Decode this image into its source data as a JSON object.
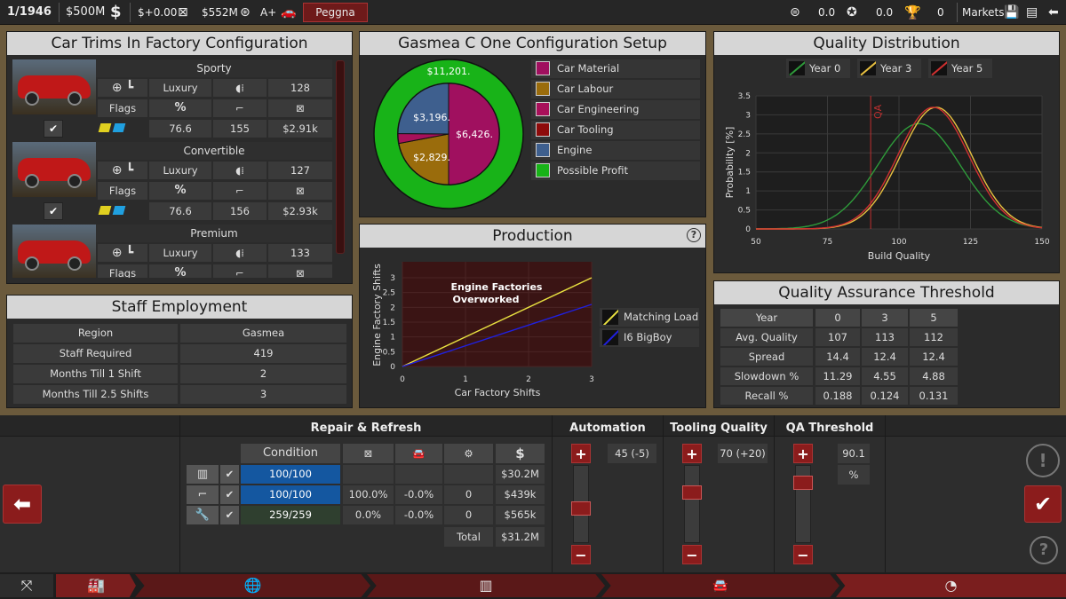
{
  "topbar": {
    "date": "1/1946",
    "money": "$500M",
    "income": "$+0.00",
    "value": "$552M",
    "rating": "A+",
    "company": "Peggna",
    "stat1": "0.0",
    "stat2": "0.0",
    "trophies": "0",
    "markets": "Markets"
  },
  "trims": {
    "title": "Car Trims In Factory Configuration",
    "items": [
      {
        "name": "Sporty",
        "tier": "Luxury",
        "sold": "128",
        "flags": "Flags",
        "pct_icon": "%",
        "v1": "76.6",
        "v2": "155",
        "price": "$2.91k"
      },
      {
        "name": "Convertible",
        "tier": "Luxury",
        "sold": "127",
        "flags": "Flags",
        "pct_icon": "%",
        "v1": "76.6",
        "v2": "156",
        "price": "$2.93k"
      },
      {
        "name": "Premium",
        "tier": "Luxury",
        "sold": "133",
        "flags": "Flags"
      }
    ]
  },
  "config": {
    "title": "Gasmea C One Configuration Setup",
    "pie_labels": {
      "profit": "$11,201.",
      "engine": "$3,196.",
      "material": "$6,426.",
      "labour": "$2,829."
    },
    "legend": [
      {
        "label": "Car Material",
        "color": "#a0105f"
      },
      {
        "label": "Car Labour",
        "color": "#9a6c0c"
      },
      {
        "label": "Car Engineering",
        "color": "#a8105a"
      },
      {
        "label": "Car Tooling",
        "color": "#8e0b0b"
      },
      {
        "label": "Engine",
        "color": "#3e5f8e"
      },
      {
        "label": "Possible Profit",
        "color": "#18b318"
      }
    ]
  },
  "quality": {
    "title": "Quality Distribution",
    "legend": [
      {
        "label": "Year 0",
        "color": "#2e9a3a"
      },
      {
        "label": "Year 3",
        "color": "#e8c040"
      },
      {
        "label": "Year 5",
        "color": "#d03030"
      }
    ],
    "qa_label": "QA"
  },
  "staff": {
    "title": "Staff Employment",
    "rows": [
      {
        "k": "Region",
        "v": "Gasmea"
      },
      {
        "k": "Staff Required",
        "v": "419"
      },
      {
        "k": "Months Till 1 Shift",
        "v": "2"
      },
      {
        "k": "Months Till 2.5 Shifts",
        "v": "3"
      }
    ]
  },
  "production": {
    "title": "Production",
    "annotation_l1": "Engine Factories",
    "annotation_l2": "Overworked",
    "legend": [
      {
        "label": "Matching Load",
        "color": "#e8e040"
      },
      {
        "label": "I6 BigBoy",
        "color": "#2020e0"
      }
    ]
  },
  "qat": {
    "title": "Quality Assurance Threshold",
    "header": [
      "Year",
      "0",
      "3",
      "5"
    ],
    "rows": [
      [
        "Avg. Quality",
        "107",
        "113",
        "112"
      ],
      [
        "Spread",
        "14.4",
        "12.4",
        "12.4"
      ],
      [
        "Slowdown %",
        "11.29",
        "4.55",
        "4.88"
      ],
      [
        "Recall %",
        "0.188",
        "0.124",
        "0.131"
      ]
    ]
  },
  "repair": {
    "title": "Repair & Refresh",
    "condition_header": "Condition",
    "dollar_header": "$",
    "rows": [
      {
        "cond": "100/100",
        "a": "",
        "b": "",
        "c": "",
        "cost": "$30.2M"
      },
      {
        "cond": "100/100",
        "a": "100.0%",
        "b": "-0.0%",
        "c": "0",
        "cost": "$439k"
      },
      {
        "cond": "259/259",
        "a": "0.0%",
        "b": "-0.0%",
        "c": "0",
        "cost": "$565k"
      }
    ],
    "total_label": "Total",
    "total": "$31.2M"
  },
  "automation": {
    "title": "Automation",
    "value": "45 (-5)",
    "level": 0.45
  },
  "tooling": {
    "title": "Tooling Quality",
    "value": "70 (+20)",
    "level": 0.7
  },
  "qa_threshold": {
    "title": "QA Threshold",
    "value": "90.1",
    "unit": "%",
    "level": 0.85
  },
  "chart_data": [
    {
      "type": "pie",
      "title": "Gasmea C One Configuration Setup",
      "slices": [
        {
          "label": "Car Material",
          "value": 6426
        },
        {
          "label": "Car Labour",
          "value": 2829
        },
        {
          "label": "Car Engineering",
          "value": 400
        },
        {
          "label": "Engine",
          "value": 3196
        }
      ],
      "outer_ring": {
        "label": "Possible Profit",
        "value": 11201
      }
    },
    {
      "type": "line",
      "title": "Quality Distribution",
      "xlabel": "Build Quality",
      "ylabel": "Probability [%]",
      "xlim": [
        50,
        150
      ],
      "ylim": [
        0,
        3.5
      ],
      "xticks": [
        "50",
        "75",
        "100",
        "125",
        "150"
      ],
      "yticks": [
        "0",
        "0.5",
        "1",
        "1.5",
        "2",
        "2.5",
        "3",
        "3.5"
      ],
      "qa_line": 90.1,
      "series": [
        {
          "name": "Year 0",
          "mean": 107,
          "spread": 14.4,
          "peak": 2.77
        },
        {
          "name": "Year 3",
          "mean": 113,
          "spread": 12.4,
          "peak": 3.2
        },
        {
          "name": "Year 5",
          "mean": 112,
          "spread": 12.4,
          "peak": 3.2
        }
      ]
    },
    {
      "type": "line",
      "title": "Production",
      "xlabel": "Car Factory Shifts",
      "ylabel": "Engine Factory Shifts",
      "xlim": [
        0,
        3
      ],
      "ylim": [
        0,
        3
      ],
      "xticks": [
        "0",
        "1",
        "2",
        "3"
      ],
      "yticks": [
        "0",
        "0.5",
        "1",
        "1.5",
        "2",
        "2.5",
        "3"
      ],
      "series": [
        {
          "name": "Matching Load",
          "x": [
            0,
            3
          ],
          "y": [
            0,
            3
          ]
        },
        {
          "name": "I6 BigBoy",
          "x": [
            0,
            3
          ],
          "y": [
            0,
            2.1
          ]
        }
      ]
    }
  ]
}
